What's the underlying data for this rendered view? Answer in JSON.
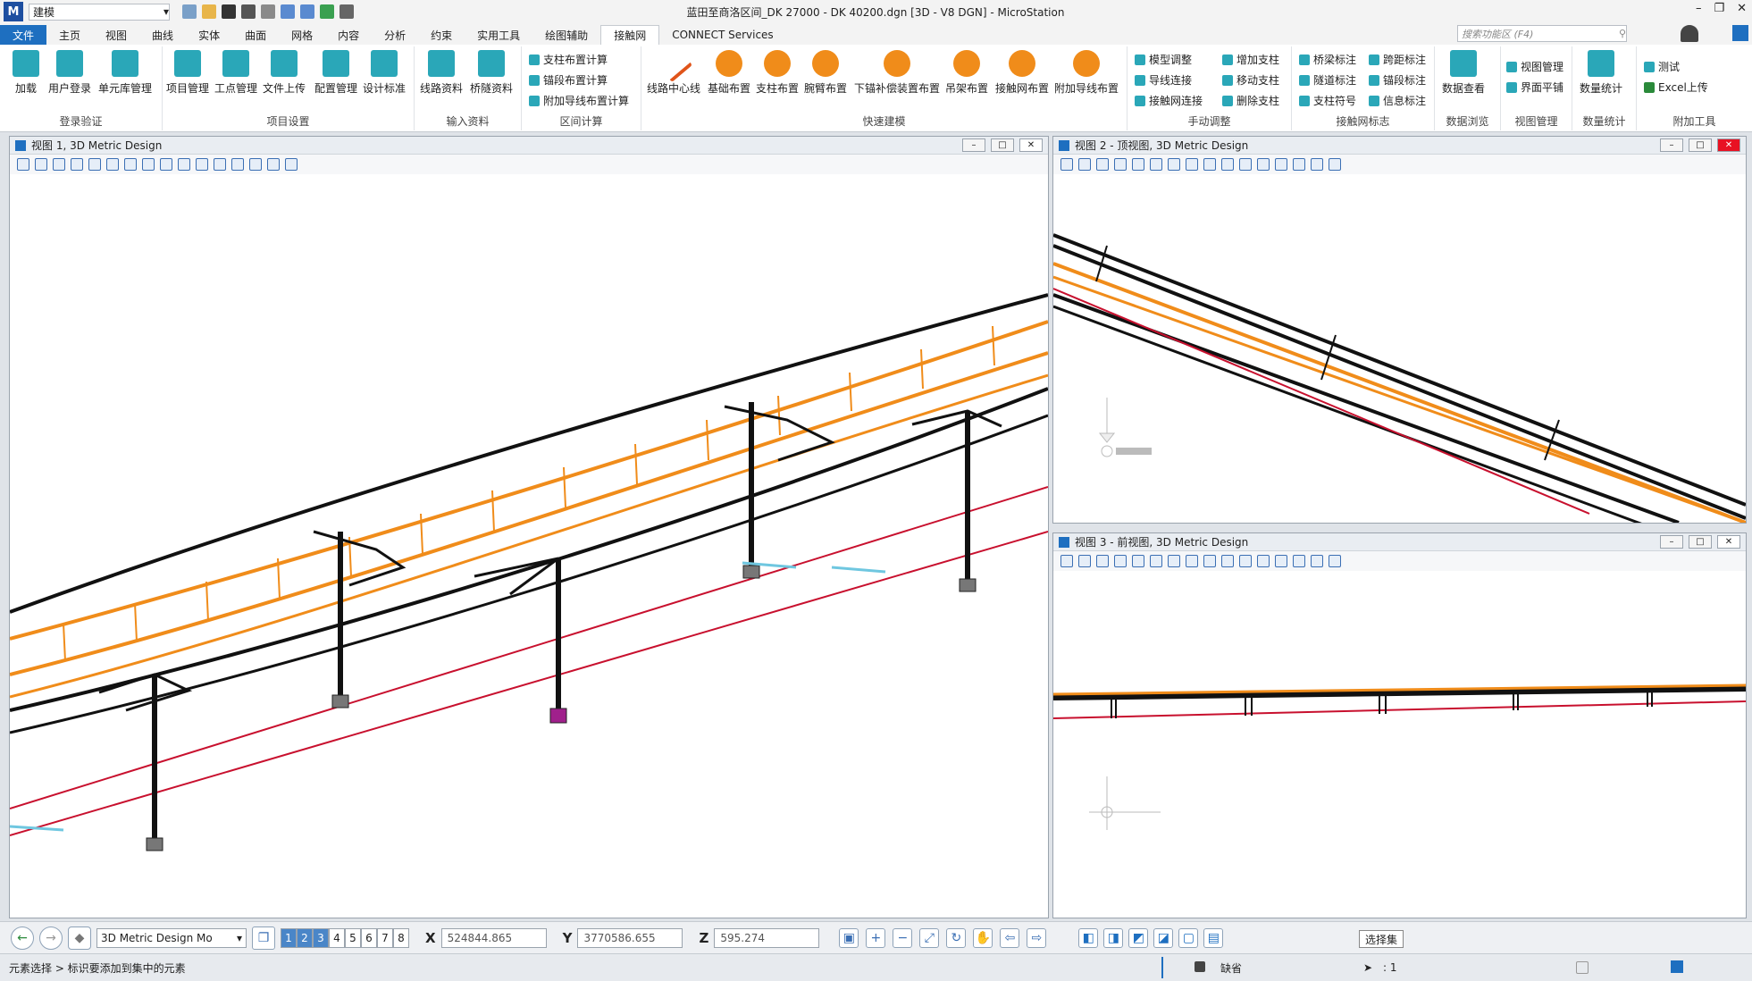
{
  "title": {
    "workspace": "建模",
    "window_title": "蓝田至商洛区间_DK 27000 - DK 40200.dgn [3D - V8 DGN] - MicroStation",
    "app_icon": "microstation-logo"
  },
  "tabs": [
    "文件",
    "主页",
    "视图",
    "曲线",
    "实体",
    "曲面",
    "网格",
    "内容",
    "分析",
    "约束",
    "实用工具",
    "绘图辅助",
    "接触网",
    "CONNECT Services"
  ],
  "search_placeholder": "搜索功能区 (F4)",
  "ribbon": {
    "groups": {
      "login": "登录验证",
      "project": "项目设置",
      "input": "输入资料",
      "section": "区间计算",
      "quick": "快速建模",
      "manual": "手动调整",
      "catenary_mark": "接触网标志",
      "data_browse": "数据浏览",
      "view_mgmt": "视图管理",
      "data_stat": "数量统计",
      "addon": "附加工具"
    },
    "login_buttons": [
      "加载",
      "用户登录",
      "单元库管理"
    ],
    "project_buttons": [
      "项目管理",
      "工点管理",
      "文件上传",
      "配置管理",
      "设计标准"
    ],
    "input_buttons": [
      "线路资料",
      "桥隧资料"
    ],
    "section_items": [
      "支柱布置计算",
      "锚段布置计算",
      "附加导线布置计算"
    ],
    "quick_buttons": [
      "线路中心线",
      "基础布置",
      "支柱布置",
      "腕臂布置",
      "下锚补偿装置布置",
      "吊架布置",
      "接触网布置",
      "附加导线布置"
    ],
    "manual_items_a": [
      "模型调整",
      "导线连接",
      "接触网连接"
    ],
    "manual_items_b": [
      "增加支柱",
      "移动支柱",
      "删除支柱"
    ],
    "mark_items_a": [
      "桥梁标注",
      "隧道标注",
      "支柱符号"
    ],
    "mark_items_b": [
      "跨距标注",
      "锚段标注",
      "信息标注"
    ],
    "data_browse_button": "数据查看",
    "view_mgmt_items": [
      "视图管理",
      "界面平铺"
    ],
    "stat_button": "数量统计",
    "addon_items": [
      "测试",
      "Excel上传"
    ]
  },
  "views": {
    "v1": "视图 1, 3D Metric Design",
    "v2": "视图 2 - 顶视图, 3D Metric Design",
    "v3": "视图 3 - 前视图, 3D Metric Design"
  },
  "status": {
    "model": "3D Metric Design Mo",
    "view_numbers": [
      "1",
      "2",
      "3",
      "4",
      "5",
      "6",
      "7",
      "8"
    ],
    "x_label": "X",
    "x_value": "524844.865",
    "y_label": "Y",
    "y_value": "3770586.655",
    "z_label": "Z",
    "z_value": "595.274",
    "tooltip": "选择集",
    "prompt": "元素选择 > 标识要添加到集中的元素",
    "level": "缺省",
    "selection_count": ": 1"
  },
  "colors": {
    "wire_black": "#111111",
    "wire_orange": "#f08c1a",
    "rail_red": "#c8102e",
    "accent_blue": "#1e6fc0",
    "cyan_mark": "#6fc7e0"
  }
}
